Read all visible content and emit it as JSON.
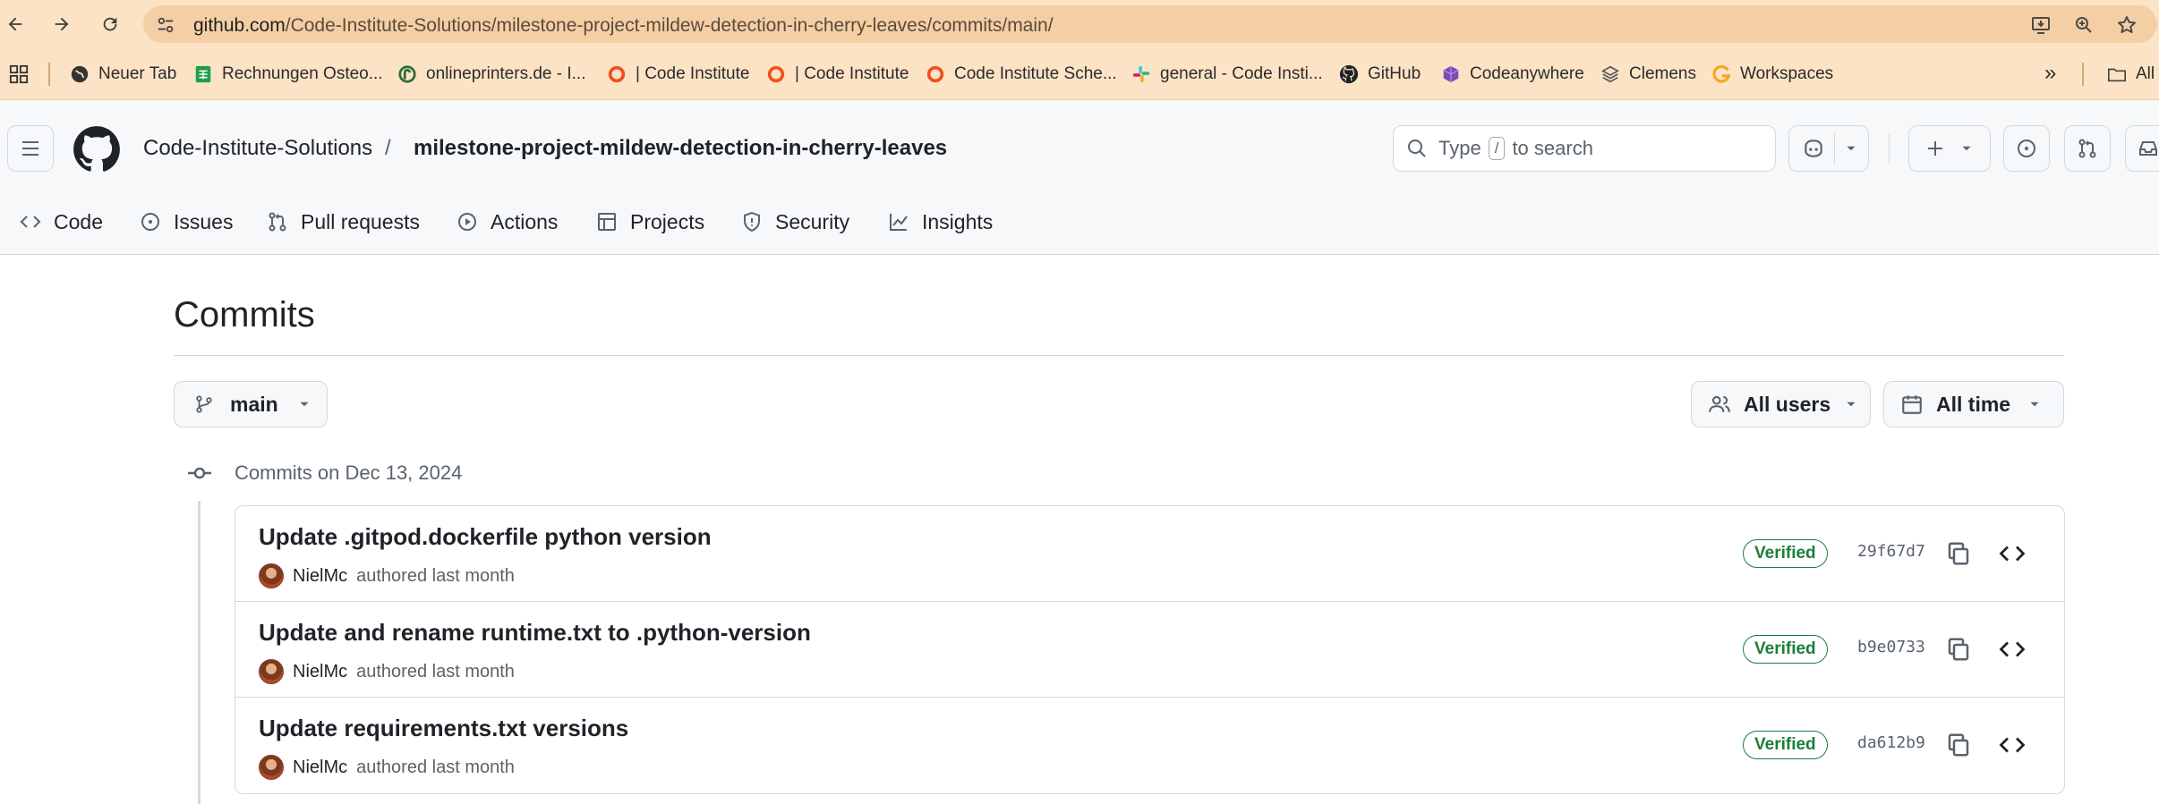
{
  "browser": {
    "url_host": "github.com",
    "url_path": "/Code-Institute-Solutions/milestone-project-mildew-detection-in-cherry-leaves/commits/main/",
    "bookmarks": [
      {
        "label": "Neuer Tab",
        "icon": "globe-icon"
      },
      {
        "label": "Rechnungen Osteo...",
        "icon": "sheets-icon"
      },
      {
        "label": "onlineprinters.de - I...",
        "icon": "printer-logo-icon"
      },
      {
        "label": "| Code Institute",
        "icon": "code-institute-icon"
      },
      {
        "label": "| Code Institute",
        "icon": "code-institute-icon"
      },
      {
        "label": "Code Institute Sche...",
        "icon": "code-institute-icon"
      },
      {
        "label": "general - Code Insti...",
        "icon": "slack-icon"
      },
      {
        "label": "GitHub",
        "icon": "github-icon"
      },
      {
        "label": "Codeanywhere",
        "icon": "codeanywhere-icon"
      },
      {
        "label": "Clemens",
        "icon": "layers-icon"
      },
      {
        "label": "Workspaces",
        "icon": "workspaces-icon"
      }
    ],
    "more_label": "»",
    "all_bookmarks_label": "All"
  },
  "header": {
    "owner": "Code-Institute-Solutions",
    "separator": "/",
    "repo": "milestone-project-mildew-detection-in-cherry-leaves",
    "search_prefix": "Type",
    "search_key": "/",
    "search_suffix": "to search"
  },
  "tabs": [
    {
      "label": "Code",
      "icon": "code-icon"
    },
    {
      "label": "Issues",
      "icon": "issue-icon"
    },
    {
      "label": "Pull requests",
      "icon": "pull-request-icon"
    },
    {
      "label": "Actions",
      "icon": "play-icon"
    },
    {
      "label": "Projects",
      "icon": "table-icon"
    },
    {
      "label": "Security",
      "icon": "shield-icon"
    },
    {
      "label": "Insights",
      "icon": "graph-icon"
    }
  ],
  "page": {
    "title": "Commits",
    "branch": "main",
    "users_filter": "All users",
    "time_filter": "All time",
    "date_heading": "Commits on Dec 13, 2024"
  },
  "commits": [
    {
      "message": "Update .gitpod.dockerfile python version",
      "author": "NielMc",
      "when": "authored last month",
      "badge": "Verified",
      "sha": "29f67d7"
    },
    {
      "message": "Update and rename runtime.txt to .python-version",
      "author": "NielMc",
      "when": "authored last month",
      "badge": "Verified",
      "sha": "b9e0733"
    },
    {
      "message": "Update requirements.txt versions",
      "author": "NielMc",
      "when": "authored last month",
      "badge": "Verified",
      "sha": "da612b9"
    }
  ],
  "colors": {
    "browser_chrome": "#fde3c6",
    "verified_green": "#1a7f37",
    "border": "#d1d9e0"
  }
}
